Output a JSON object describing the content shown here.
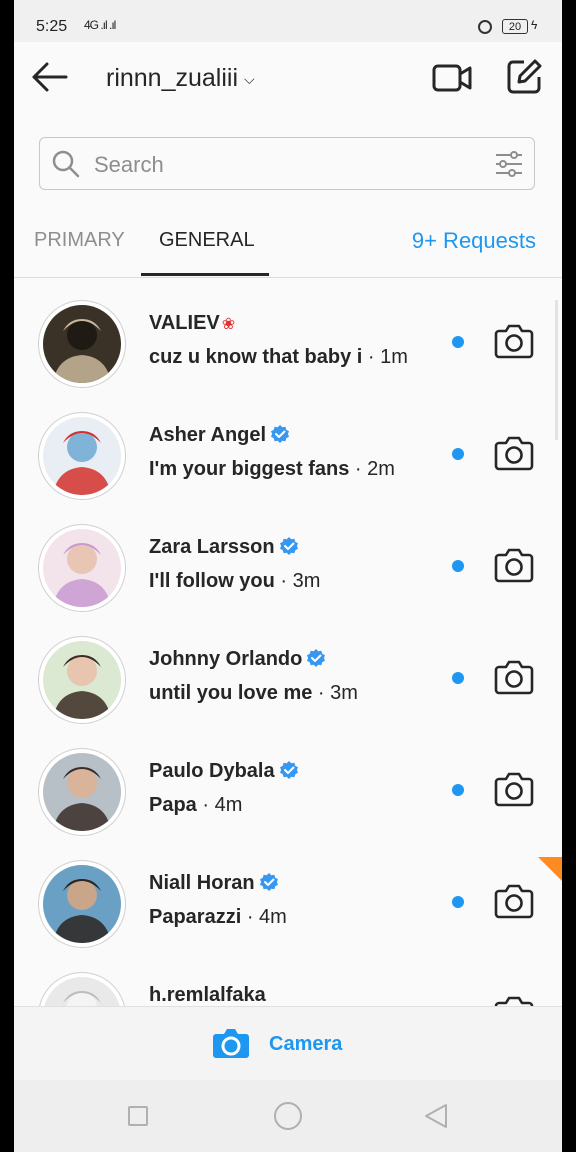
{
  "status_bar": {
    "time": "5:25",
    "signal": "4G .ıl .ıl",
    "battery": "20"
  },
  "header": {
    "account_name": "rinnn_zualiii",
    "chevron": "chevron-down-icon",
    "back_icon": "back-arrow-icon",
    "video_icon": "video-camera-icon",
    "compose_icon": "new-message-icon"
  },
  "search": {
    "placeholder": "Search",
    "filter_icon": "filter-sliders-icon"
  },
  "tabs": {
    "primary": "PRIMARY",
    "general": "GENERAL",
    "requests": "9+ Requests",
    "active": "GENERAL"
  },
  "conversations": [
    {
      "name": "VALIEV",
      "verified": false,
      "message": "cuz u know that baby i",
      "time": "· 1m",
      "unread": true
    },
    {
      "name": "Asher Angel",
      "verified": true,
      "message": "I'm your biggest fans",
      "time": "· 2m",
      "unread": true
    },
    {
      "name": "Zara Larsson",
      "verified": true,
      "message": "I'll follow you",
      "time": "· 3m",
      "unread": true
    },
    {
      "name": "Johnny Orlando",
      "verified": true,
      "message": "until you love me",
      "time": "· 3m",
      "unread": true
    },
    {
      "name": "Paulo Dybala",
      "verified": true,
      "message": "Papa",
      "time": "· 4m",
      "unread": true
    },
    {
      "name": "Niall Horan",
      "verified": true,
      "message": "Paparazzi",
      "time": "· 4m",
      "unread": true
    },
    {
      "name": "h.remlalfaka",
      "verified": false,
      "message": "",
      "time": "",
      "unread": false
    }
  ],
  "bottom_bar": {
    "label": "Camera"
  },
  "colors": {
    "accent": "#1e97f0",
    "verified": "#3897f0",
    "text": "#262626",
    "muted": "#8e8e8e"
  }
}
